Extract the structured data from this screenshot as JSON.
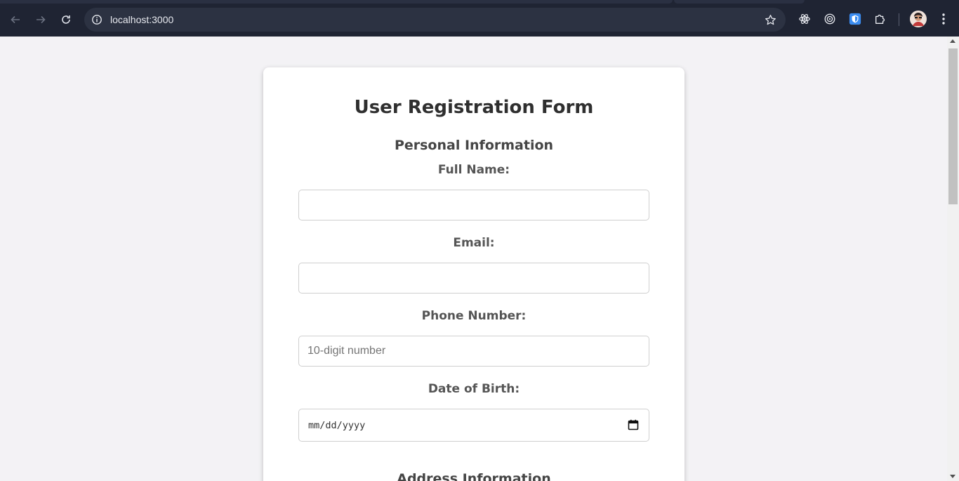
{
  "browser": {
    "url": "localhost:3000",
    "icons": [
      "back-icon",
      "forward-icon",
      "reload-icon",
      "site-info-icon",
      "bookmark-star-icon",
      "react-devtools-icon",
      "target-extension-icon",
      "shield-extension-icon",
      "extensions-puzzle-icon",
      "profile-avatar",
      "menu-kebab-icon"
    ]
  },
  "form": {
    "title": "User Registration Form",
    "personal_section": "Personal Information",
    "full_name_label": "Full Name:",
    "full_name_value": "",
    "email_label": "Email:",
    "email_value": "",
    "phone_label": "Phone Number:",
    "phone_placeholder": "10-digit number",
    "dob_label": "Date of Birth:",
    "dob_placeholder": "mm/dd/yyyy",
    "address_section": "Address Information"
  },
  "colors": {
    "chrome_bg": "#1f2433",
    "page_bg": "#f3f2f5",
    "card_bg": "#ffffff"
  }
}
